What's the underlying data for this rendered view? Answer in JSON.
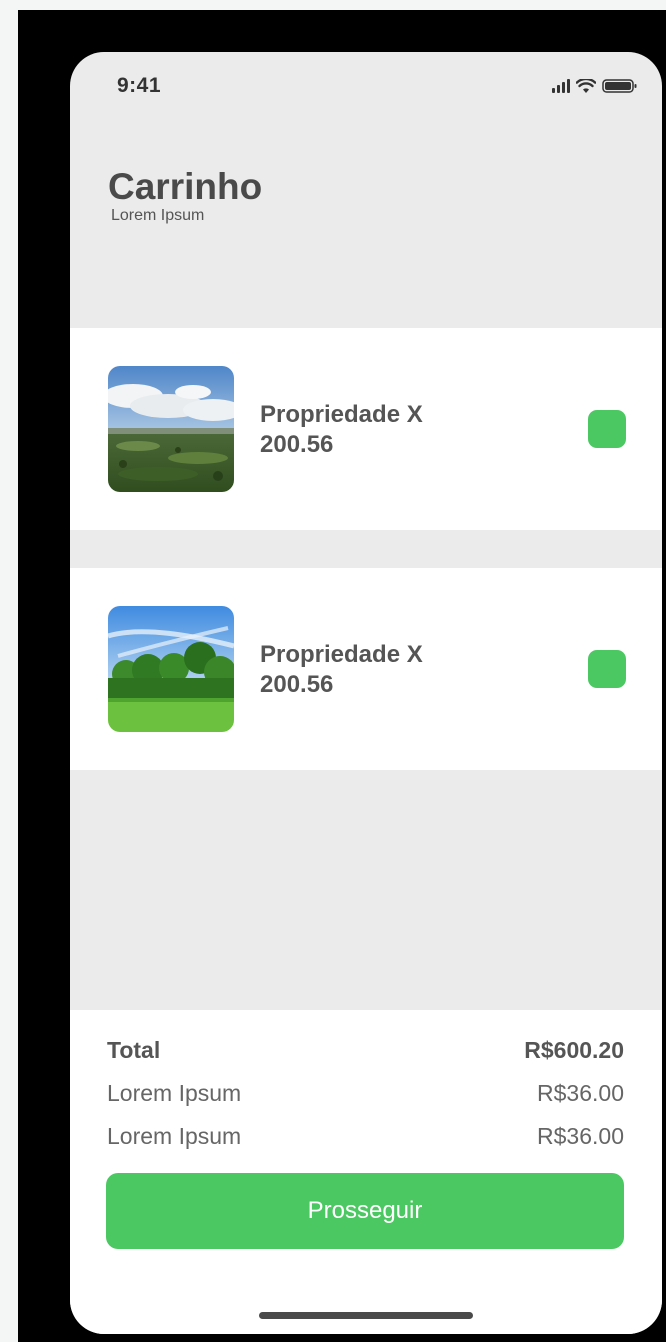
{
  "status_bar": {
    "time": "9:41",
    "icons": [
      "signal-icon",
      "wifi-icon",
      "battery-icon"
    ]
  },
  "header": {
    "title": "Carrinho",
    "subtitle": "Lorem Ipsum"
  },
  "items": [
    {
      "name": "Propriedade X",
      "price": "200.56",
      "image": "landscape-hills-photo",
      "checked": true
    },
    {
      "name": "Propriedade X",
      "price": "200.56",
      "image": "landscape-trees-photo",
      "checked": true
    }
  ],
  "summary": {
    "total_label": "Total",
    "total_value": "R$600.20",
    "fees": [
      {
        "label": "Lorem Ipsum",
        "value": "R$36.00"
      },
      {
        "label": "Lorem Ipsum",
        "value": "R$36.00"
      }
    ]
  },
  "actions": {
    "proceed_label": "Prosseguir"
  },
  "colors": {
    "accent": "#4cc862",
    "background": "#ebebeb",
    "card": "#ffffff"
  }
}
